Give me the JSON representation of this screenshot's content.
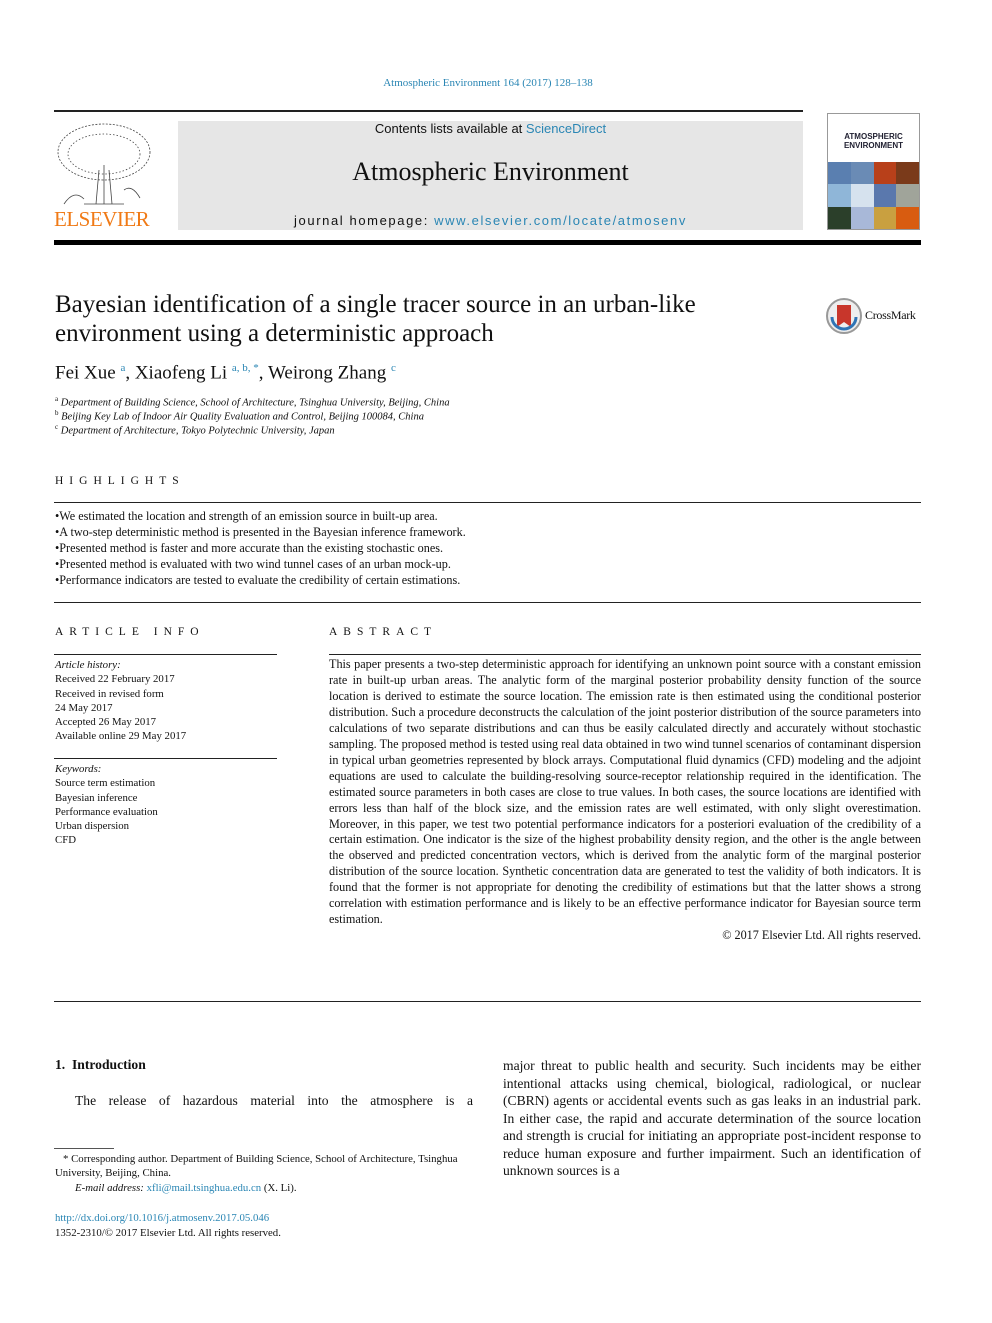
{
  "citation": "Atmospheric Environment 164 (2017) 128–138",
  "header": {
    "contents_prefix": "Contents lists available at ",
    "contents_link": "ScienceDirect",
    "journal_title": "Atmospheric Environment",
    "homepage_prefix": "journal homepage: ",
    "homepage_link": "www.elsevier.com/locate/atmosenv",
    "publisher_logo": "ELSEVIER",
    "cover_title": "ATMOSPHERIC ENVIRONMENT"
  },
  "title": "Bayesian identification of a single tracer source in an urban-like environment using a deterministic approach",
  "crossmark": "CrossMark",
  "authors": [
    {
      "name": "Fei Xue",
      "sup": "a"
    },
    {
      "name": "Xiaofeng Li",
      "sup": "a, b, *"
    },
    {
      "name": "Weirong Zhang",
      "sup": "c"
    }
  ],
  "affiliations": [
    {
      "mark": "a",
      "text": "Department of Building Science, School of Architecture, Tsinghua University, Beijing, China"
    },
    {
      "mark": "b",
      "text": "Beijing Key Lab of Indoor Air Quality Evaluation and Control, Beijing 100084, China"
    },
    {
      "mark": "c",
      "text": "Department of Architecture, Tokyo Polytechnic University, Japan"
    }
  ],
  "highlights": {
    "heading": "HIGHLIGHTS",
    "items": [
      "We estimated the location and strength of an emission source in built-up area.",
      "A two-step deterministic method is presented in the Bayesian inference framework.",
      "Presented method is faster and more accurate than the existing stochastic ones.",
      "Presented method is evaluated with two wind tunnel cases of an urban mock-up.",
      "Performance indicators are tested to evaluate the credibility of certain estimations."
    ]
  },
  "article_info": {
    "heading": "ARTICLE INFO",
    "history_label": "Article history:",
    "history": [
      "Received 22 February 2017",
      "Received in revised form",
      "24 May 2017",
      "Accepted 26 May 2017",
      "Available online 29 May 2017"
    ],
    "keywords_label": "Keywords:",
    "keywords": [
      "Source term estimation",
      "Bayesian inference",
      "Performance evaluation",
      "Urban dispersion",
      "CFD"
    ]
  },
  "abstract": {
    "heading": "ABSTRACT",
    "text": "This paper presents a two-step deterministic approach for identifying an unknown point source with a constant emission rate in built-up urban areas. The analytic form of the marginal posterior probability density function of the source location is derived to estimate the source location. The emission rate is then estimated using the conditional posterior distribution. Such a procedure deconstructs the calculation of the joint posterior distribution of the source parameters into calculations of two separate distributions and can thus be easily calculated directly and accurately without stochastic sampling. The proposed method is tested using real data obtained in two wind tunnel scenarios of contaminant dispersion in typical urban geometries represented by block arrays. Computational fluid dynamics (CFD) modeling and the adjoint equations are used to calculate the building-resolving source-receptor relationship required in the identification. The estimated source parameters in both cases are close to true values. In both cases, the source locations are identified with errors less than half of the block size, and the emission rates are well estimated, with only slight overestimation. Moreover, in this paper, we test two potential performance indicators for a posteriori evaluation of the credibility of a certain estimation. One indicator is the size of the highest probability density region, and the other is the angle between the observed and predicted concentration vectors, which is derived from the analytic form of the marginal posterior distribution of the source location. Synthetic concentration data are generated to test the validity of both indicators. It is found that the former is not appropriate for denoting the credibility of estimations but that the latter shows a strong correlation with estimation performance and is likely to be an effective performance indicator for Bayesian source term estimation.",
    "copyright": "© 2017 Elsevier Ltd. All rights reserved."
  },
  "intro": {
    "heading": "1.  Introduction",
    "left_text": "The release of hazardous material into the atmosphere is a",
    "right_text": "major threat to public health and security. Such incidents may be either intentional attacks using chemical, biological, radiological, or nuclear (CBRN) agents or accidental events such as gas leaks in an industrial park. In either case, the rapid and accurate determination of the source location and strength is crucial for initiating an appropriate post-incident response to reduce human exposure and further impairment. Such an identification of unknown sources is a"
  },
  "footnote": {
    "text": "* Corresponding author. Department of Building Science, School of Architecture, Tsinghua University, Beijing, China.",
    "email_label": "E-mail address: ",
    "email": "xfli@mail.tsinghua.edu.cn",
    "email_suffix": " (X. Li)."
  },
  "doi": "http://dx.doi.org/10.1016/j.atmosenv.2017.05.046",
  "issn": "1352-2310/© 2017 Elsevier Ltd. All rights reserved."
}
